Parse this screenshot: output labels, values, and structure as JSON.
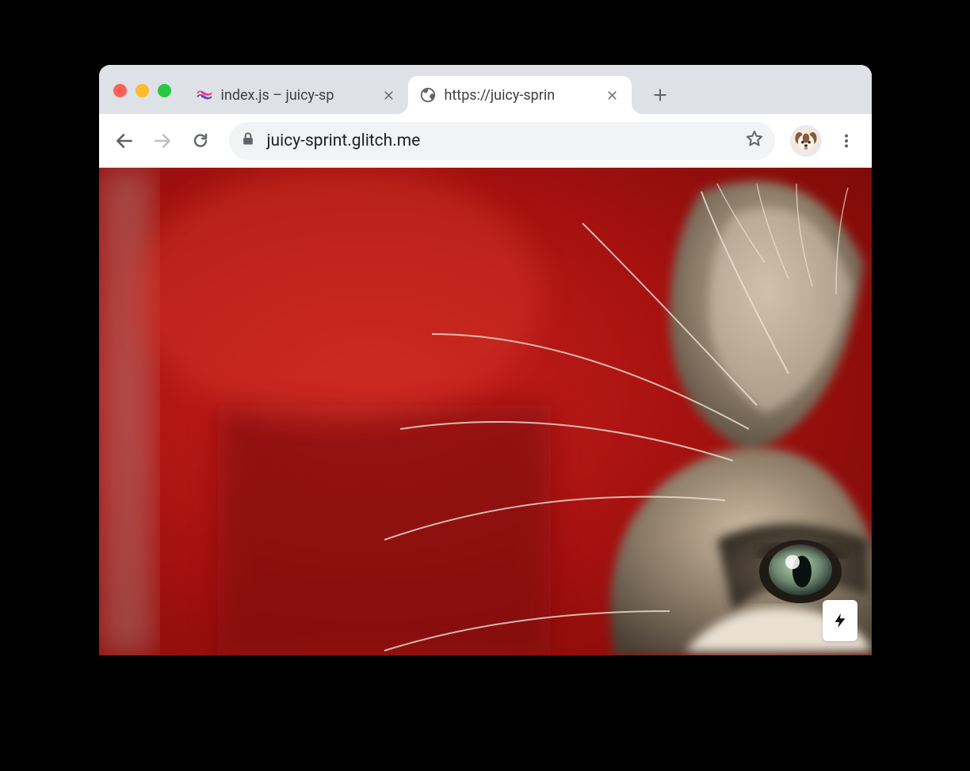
{
  "tabs": [
    {
      "title": "index.js – juicy-sp",
      "active": false,
      "favicon": "glitch"
    },
    {
      "title": "https://juicy-sprin",
      "active": true,
      "favicon": "globe"
    }
  ],
  "toolbar": {
    "url": "juicy-sprint.glitch.me"
  },
  "content": {
    "image_subject": "kitten-on-red-background",
    "badge": "amp"
  }
}
